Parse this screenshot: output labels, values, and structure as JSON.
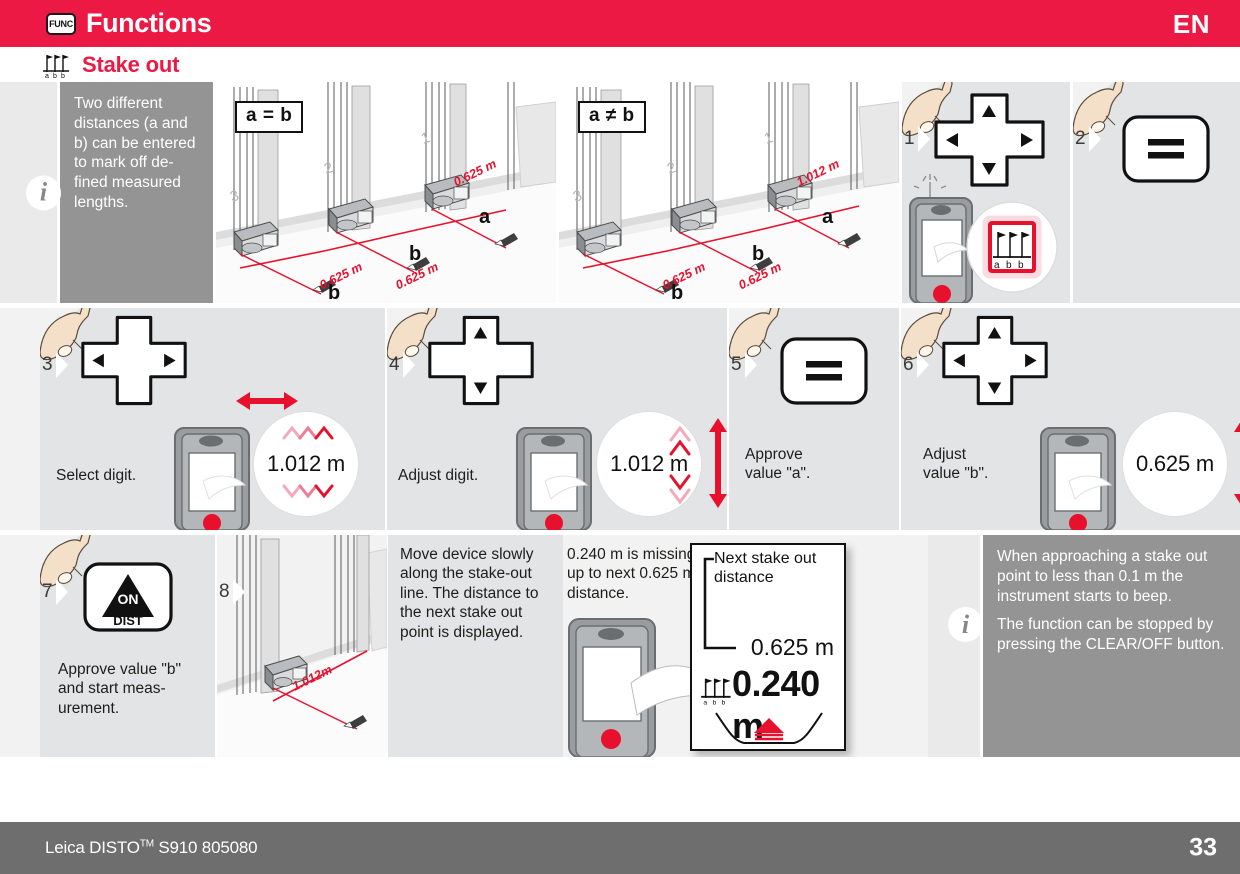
{
  "header": {
    "func_key_label": "FUNC",
    "title": "Functions",
    "language": "EN",
    "section_title": "Stake out",
    "section_icon": "stake-out-icon"
  },
  "row1": {
    "info": {
      "icon": "info-icon",
      "text": "Two different distances (a and b) can be entered to mark off de-fined measured lengths."
    },
    "scene_equal": {
      "tag": "a = b",
      "markers": [
        "3",
        "2",
        "1"
      ],
      "dim_labels": [
        "0.625 m",
        "0.625 m",
        "0.625 m"
      ],
      "point_labels": [
        "b",
        "b",
        "a"
      ]
    },
    "scene_unequal": {
      "tag": "a ≠ b",
      "markers": [
        "3",
        "2",
        "1"
      ],
      "dim_labels": [
        "0.625 m",
        "0.625 m",
        "1.012 m"
      ],
      "point_labels": [
        "b",
        "b",
        "a"
      ]
    },
    "step1": {
      "number": "1",
      "key": "navigation-cross-key",
      "display": "a b b"
    },
    "step2": {
      "number": "2",
      "key": "equals-key"
    }
  },
  "row2": {
    "step3": {
      "number": "3",
      "key": "navigation-left-right-key",
      "caption": "Select digit.",
      "display": "1.012 m"
    },
    "step4": {
      "number": "4",
      "key": "navigation-up-down-key",
      "caption": "Adjust digit.",
      "display": "1.012 m"
    },
    "step5": {
      "number": "5",
      "key": "equals-key",
      "caption": "Approve\nvalue \"a\"."
    },
    "step6": {
      "number": "6",
      "key": "navigation-cross-key",
      "caption": "Adjust\nvalue \"b\".",
      "display": "0.625 m"
    }
  },
  "row3": {
    "step7": {
      "number": "7",
      "key": "on-dist-key",
      "key_label_top": "ON",
      "key_label_bottom": "DIST",
      "caption": "Approve value \"b\" and start meas-urement."
    },
    "step8": {
      "number": "8",
      "dim_label": "1.012m",
      "caption_left": "Move device slowly along the stake-out line. The distance to the next stake out point is displayed.",
      "caption_right": "0.240 m is missing up to next 0.625 m distance.",
      "display": {
        "annotation": "Next stake out distance",
        "secondary_value": "0.625 m",
        "primary_value": "0.240 m",
        "icon": "stake-out-icon"
      }
    },
    "info": {
      "icon": "info-icon",
      "text_1": "When approaching a stake out point to less than 0.1 m the instrument starts to beep.",
      "text_2": "The function can be stopped by pressing the CLEAR/OFF button."
    }
  },
  "footer": {
    "product": "Leica DISTO",
    "trademark": "TM",
    "model": " S910 805080",
    "page": "33"
  },
  "colors": {
    "brand_red": "#ec1944",
    "note_grey": "#949494",
    "panel_grey": "#e3e4e5",
    "footer_grey": "#6e6e6e"
  }
}
